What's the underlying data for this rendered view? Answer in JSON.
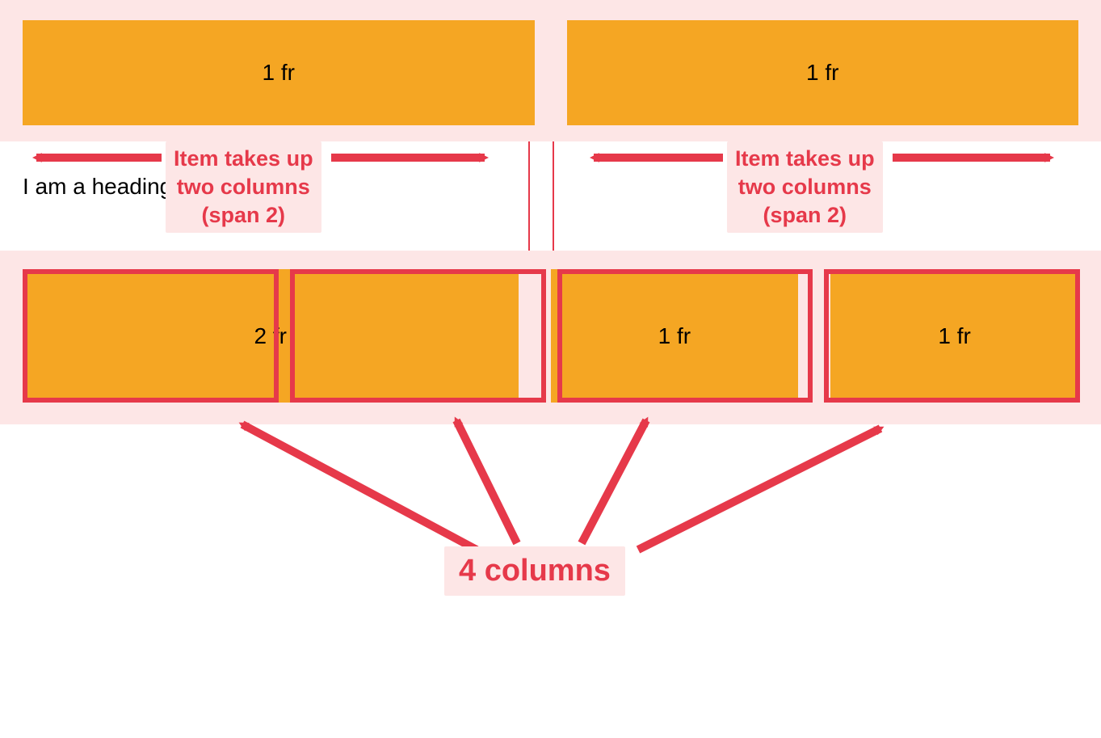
{
  "top_grid": {
    "left_label": "1 fr",
    "right_label": "1 fr"
  },
  "heading_text": "I am a heading",
  "bottom_grid": {
    "col1_label": "2 fr",
    "col2_label": "1 fr",
    "col3_label": "1 fr"
  },
  "annotations": {
    "span_left_line1": "Item takes up",
    "span_left_line2": "two columns",
    "span_left_line3": "(span 2)",
    "span_right_line1": "Item takes up",
    "span_right_line2": "two columns",
    "span_right_line3": "(span 2)",
    "four_columns": "4 columns"
  },
  "colors": {
    "accent": "#e6394a",
    "fill": "#f5a623",
    "pink": "#fde6e6"
  }
}
